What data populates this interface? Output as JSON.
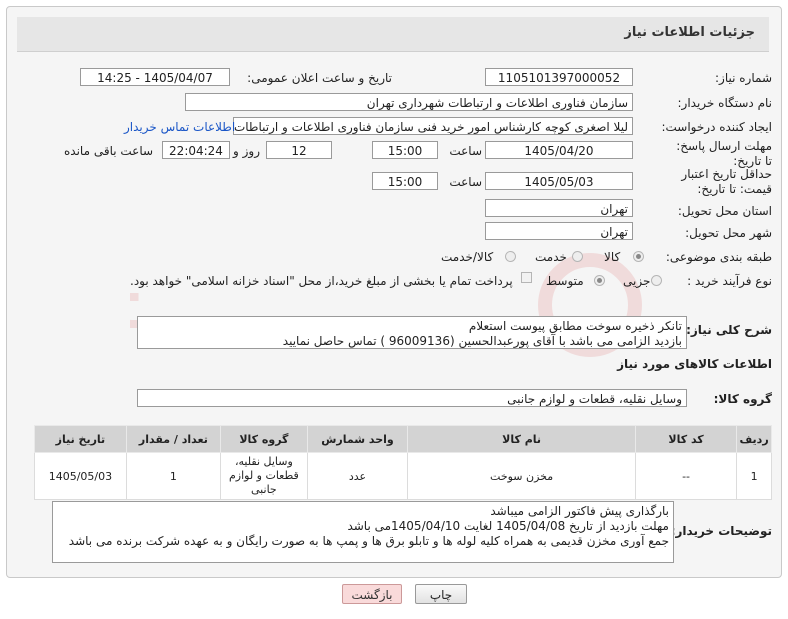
{
  "header": {
    "title": "جزئیات اطلاعات نیاز"
  },
  "fields": {
    "need_number_label": "شماره نیاز:",
    "need_number": "1105101397000052",
    "announce_label": "تاریخ و ساعت اعلان عمومی:",
    "announce_value": "1405/04/07 - 14:25",
    "buyer_org_label": "نام دستگاه خریدار:",
    "buyer_org": "سازمان فناوری اطلاعات و ارتباطات شهرداری تهران",
    "requester_label": "ایجاد کننده درخواست:",
    "requester": "لیلا اصغری کوچه کارشناس امور خرید فنی سازمان فناوری اطلاعات و ارتباطات ش",
    "contact_link": "اطلاعات تماس خریدار",
    "reply_deadline_label": "مهلت ارسال پاسخ: تا تاریخ:",
    "reply_date": "1405/04/20",
    "time_word": "ساعت",
    "reply_time": "15:00",
    "days_value": "12",
    "days_word": "روز و",
    "remaining_time": "22:04:24",
    "remaining_word": "ساعت باقی مانده",
    "price_validity_label": "حداقل تاریخ اعتبار قیمت: تا تاریخ:",
    "price_date": "1405/05/03",
    "price_time": "15:00",
    "province_label": "استان محل تحویل:",
    "province": "تهران",
    "city_label": "شهر محل تحویل:",
    "city": "تهران",
    "category_label": "طبقه بندی موضوعی:",
    "category_options": [
      "کالا",
      "خدمت",
      "کالا/خدمت"
    ],
    "process_label": "نوع فرآیند خرید :",
    "process_options": [
      "جزیی",
      "متوسط"
    ],
    "payment_note": "پرداخت تمام یا بخشی از مبلغ خرید،از محل \"اسناد خزانه اسلامی\" خواهد بود."
  },
  "description": {
    "label": "شرح کلی نیاز:",
    "lines": [
      "تانکر ذخیره سوخت مطابق پیوست استعلام",
      "بازدید الزامی می باشد  با آقای پورعبدالحسین (96009136  ) تماس حاصل نمایید"
    ]
  },
  "goods_section": {
    "title": "اطلاعات کالاهای مورد نیاز",
    "group_label": "گروه کالا:",
    "group_value": "وسایل نقلیه، قطعات و لوازم جانبی"
  },
  "table": {
    "headers": [
      "ردیف",
      "کد کالا",
      "نام کالا",
      "واحد شمارش",
      "گروه کالا",
      "تعداد / مقدار",
      "تاریخ نیاز"
    ],
    "rows": [
      {
        "row": "1",
        "code": "--",
        "name": "مخزن سوخت",
        "unit": "عدد",
        "group": "وسایل نقلیه، قطعات و لوازم جانبی",
        "qty": "1",
        "date": "1405/05/03"
      }
    ]
  },
  "buyer_notes": {
    "label": "توضیحات خریدار:",
    "lines": [
      "بارگذاری پیش فاکتور الزامی میباشد",
      "مهلت بازدید از تاریخ 1405/04/08 لغایت 1405/04/10می باشد",
      "جمع آوری مخزن قدیمی به همراه کلیه لوله ها و تابلو برق ها و پمپ ها به صورت رایگان و به عهده شرکت برنده می باشد"
    ]
  },
  "buttons": {
    "back": "بازگشت",
    "print": "چاپ"
  },
  "watermark_text": "AriaTender.net",
  "colors": {
    "link": "#1a56c7",
    "back_button_bg": "#f9dada",
    "table_header": "#d3d3d3"
  }
}
